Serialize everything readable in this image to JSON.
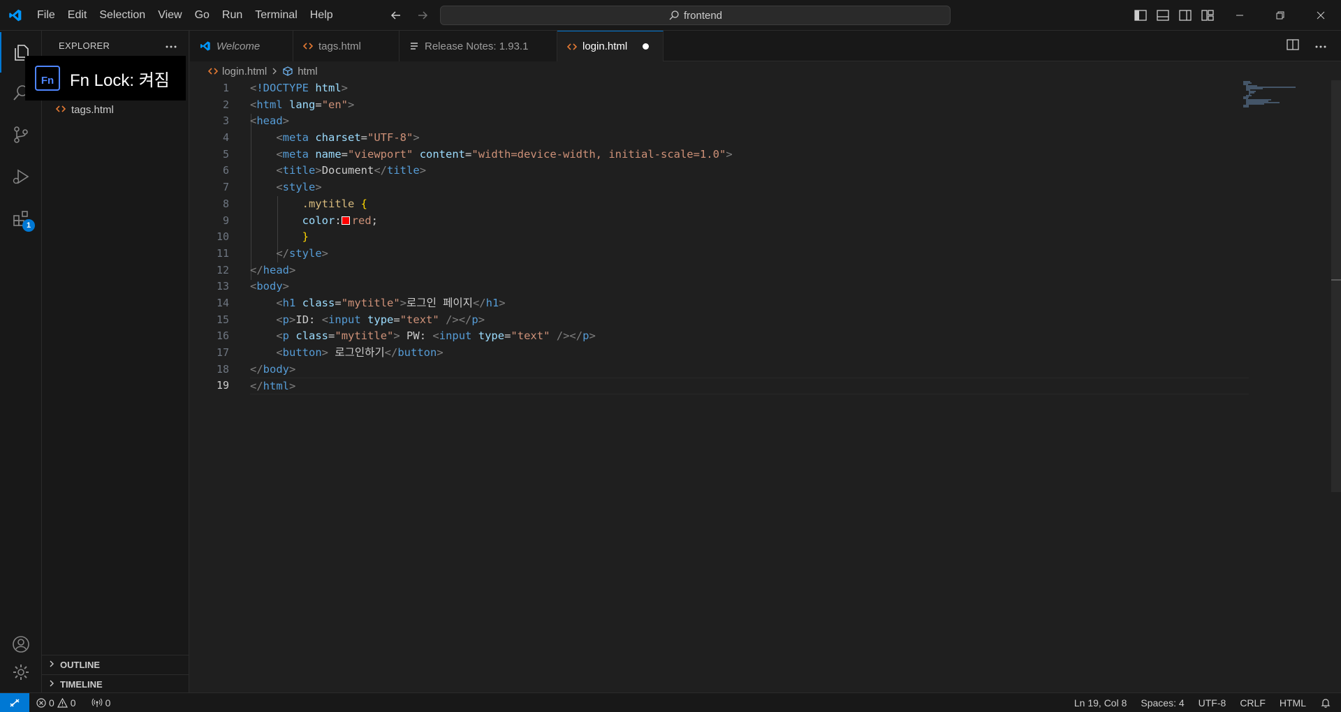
{
  "menu": [
    "File",
    "Edit",
    "Selection",
    "View",
    "Go",
    "Run",
    "Terminal",
    "Help"
  ],
  "search": {
    "text": "frontend"
  },
  "sidebar": {
    "title": "EXPLORER",
    "files": [
      {
        "name": "tags.html"
      }
    ],
    "sections": [
      "OUTLINE",
      "TIMELINE"
    ]
  },
  "activity": {
    "extensions_badge": "1"
  },
  "fn_lock": {
    "label": "Fn",
    "text": "Fn Lock: 켜짐"
  },
  "tabs": [
    {
      "label": "Welcome",
      "icon": "vscode-icon",
      "italic": true
    },
    {
      "label": "tags.html",
      "icon": "html-icon"
    },
    {
      "label": "Release Notes: 1.93.1",
      "icon": "release-notes-icon"
    },
    {
      "label": "login.html",
      "icon": "html-icon",
      "active": true,
      "modified": true
    }
  ],
  "breadcrumb": {
    "file": "login.html",
    "symbol": "html"
  },
  "editor": {
    "current_line": 19,
    "lines": [
      "<!DOCTYPE html>",
      "<html lang=\"en\">",
      "<head>",
      "    <meta charset=\"UTF-8\">",
      "    <meta name=\"viewport\" content=\"width=device-width, initial-scale=1.0\">",
      "    <title>Document</title>",
      "    <style>",
      "        .mytitle {",
      "        color: red;",
      "        }",
      "    </style>",
      "</head>",
      "<body>",
      "    <h1 class=\"mytitle\">로그인 페이지</h1>",
      "    <p>ID: <input type=\"text\" /></p>",
      "    <p class=\"mytitle\"> PW: <input type=\"text\" /></p>",
      "    <button> 로그인하기</button>",
      "</body>",
      "</html>"
    ]
  },
  "status": {
    "errors": "0",
    "warnings": "0",
    "ports": "0",
    "position": "Ln 19, Col 8",
    "spaces": "Spaces: 4",
    "encoding": "UTF-8",
    "eol": "CRLF",
    "language": "HTML"
  },
  "colors": {
    "accent": "#0078d4",
    "swatch": "#ff0000"
  }
}
